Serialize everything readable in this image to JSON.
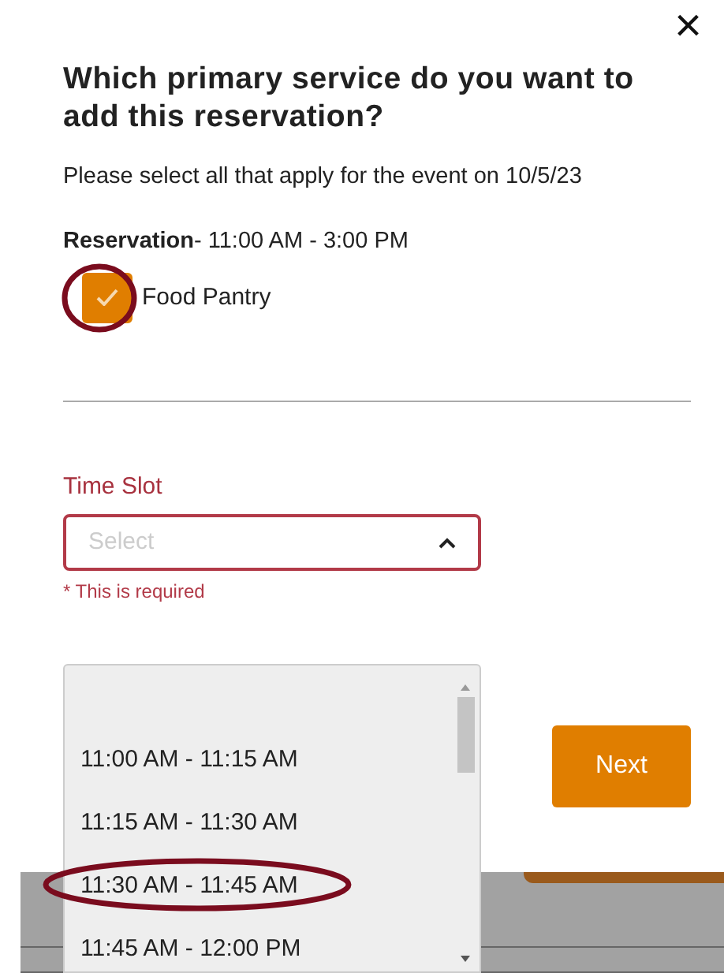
{
  "dialog": {
    "close": "×",
    "title": "Which primary service do you want to add this reservation?",
    "description": "Please select all that apply for the event on 10/5/23",
    "reservation": {
      "label": "Reservation",
      "time": "- 11:00 AM - 3:00 PM"
    },
    "services": [
      {
        "label": "Food Pantry",
        "checked": true,
        "highlighted": true
      }
    ],
    "time_slot": {
      "label": "Time Slot",
      "placeholder": "Select",
      "expanded": true,
      "error": "* This is required",
      "options": [
        {
          "label": "11:00 AM - 11:15 AM",
          "highlighted": false
        },
        {
          "label": "11:15 AM - 11:30 AM",
          "highlighted": false
        },
        {
          "label": "11:30 AM - 11:45 AM",
          "highlighted": true
        },
        {
          "label": "11:45 AM - 12:00 PM",
          "highlighted": false
        }
      ]
    },
    "next_button": "Next"
  }
}
